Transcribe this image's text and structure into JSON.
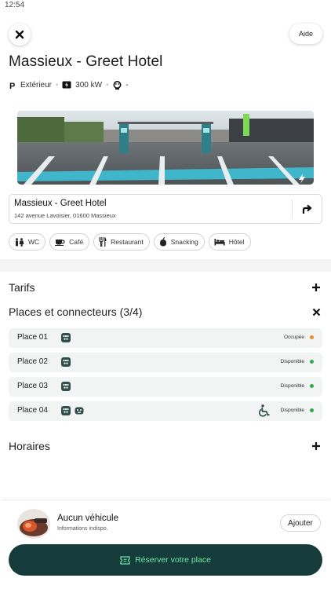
{
  "status_bar": {
    "time": "12:54"
  },
  "header": {
    "close_label": "",
    "help_label": "Aide",
    "title": "Massieux - Greet Hotel"
  },
  "meta": {
    "parking": "Extérieur",
    "power": "300 kW",
    "connector_info": "-"
  },
  "address": {
    "name": "Massieux - Greet Hotel",
    "line": "142 avenue Lavoisier, 01600 Massieux"
  },
  "amenities": [
    {
      "label": "WC",
      "icon": "wc-icon"
    },
    {
      "label": "Café",
      "icon": "coffee-icon"
    },
    {
      "label": "Restaurant",
      "icon": "restaurant-icon"
    },
    {
      "label": "Snacking",
      "icon": "snacking-icon"
    },
    {
      "label": "Hôtel",
      "icon": "hotel-icon"
    }
  ],
  "sections": {
    "tarifs": "Tarifs",
    "places": "Places et connecteurs (3/4)",
    "horaires": "Horaires"
  },
  "places": [
    {
      "label": "Place 01",
      "status": "Occupée",
      "status_color": "#f08a24"
    },
    {
      "label": "Place 02",
      "status": "Disponible",
      "status_color": "#2fa84f"
    },
    {
      "label": "Place 03",
      "status": "Disponible",
      "status_color": "#2fa84f"
    },
    {
      "label": "Place 04",
      "status": "Disponible",
      "status_color": "#2fa84f"
    }
  ],
  "vehicle": {
    "name": "Aucun véhicule",
    "subtitle": "Informations indispo.",
    "add_label": "Ajouter"
  },
  "reserve": {
    "label": "Réserver votre place"
  },
  "colors": {
    "accent_dark": "#153b3a",
    "accent_green": "#6ee9a8",
    "occupied": "#f08a24",
    "available": "#2fa84f"
  }
}
